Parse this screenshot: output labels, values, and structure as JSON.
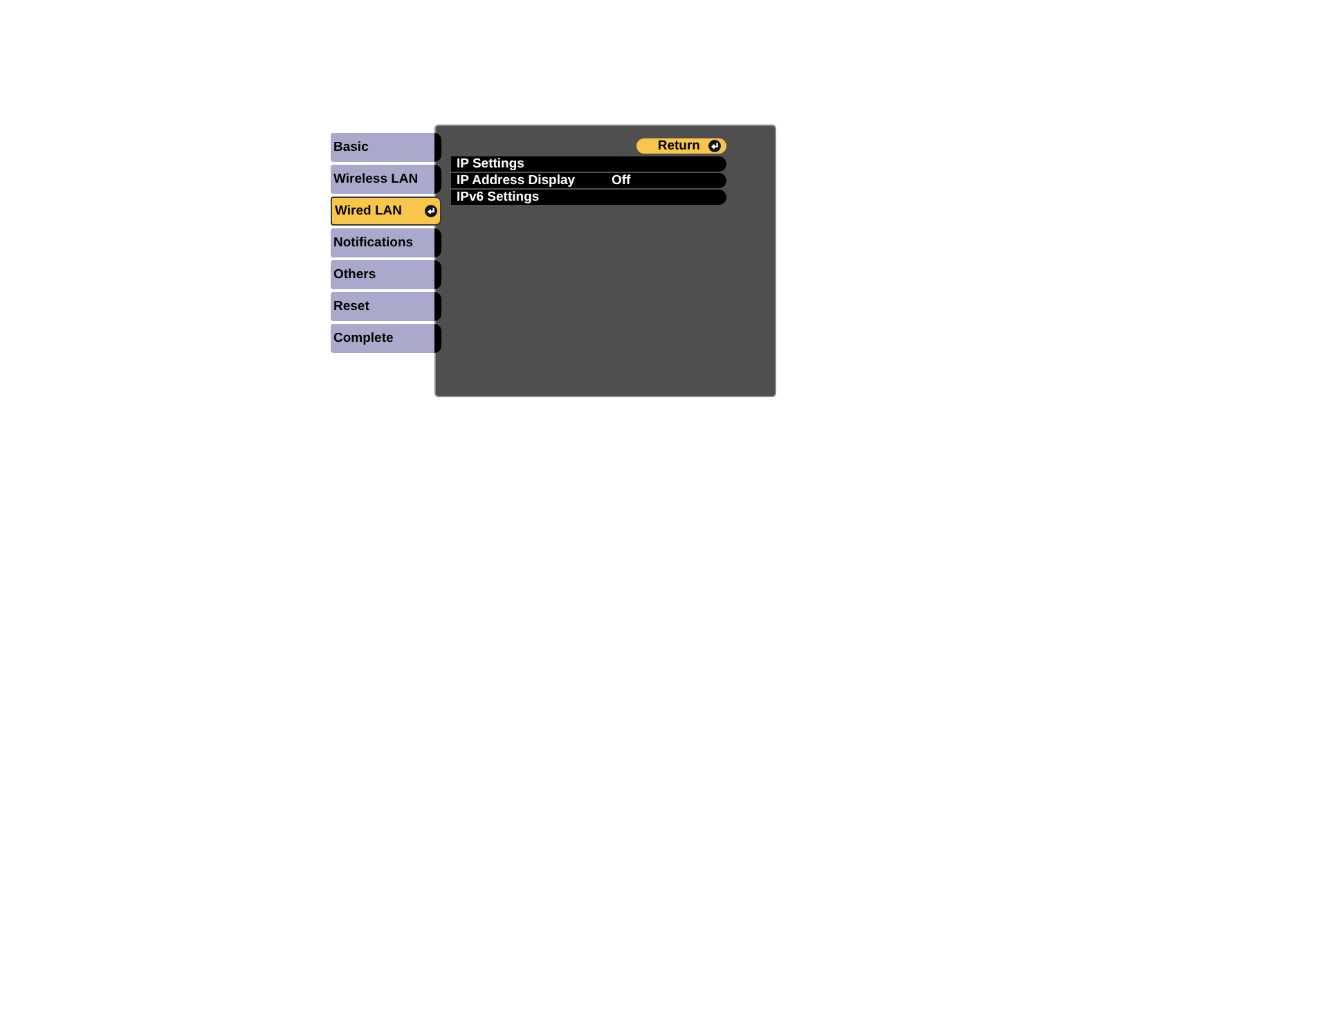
{
  "sidebar": {
    "items": [
      {
        "label": "Basic",
        "selected": false
      },
      {
        "label": "Wireless LAN",
        "selected": false
      },
      {
        "label": "Wired LAN",
        "selected": true
      },
      {
        "label": "Notifications",
        "selected": false
      },
      {
        "label": "Others",
        "selected": false
      },
      {
        "label": "Reset",
        "selected": false
      },
      {
        "label": "Complete",
        "selected": false
      }
    ]
  },
  "panel": {
    "return_button": {
      "label": "Return"
    },
    "rows": [
      {
        "label": "IP Settings"
      },
      {
        "label": "IP Address Display",
        "value": "Off"
      },
      {
        "label": "IPv6 Settings"
      }
    ]
  }
}
